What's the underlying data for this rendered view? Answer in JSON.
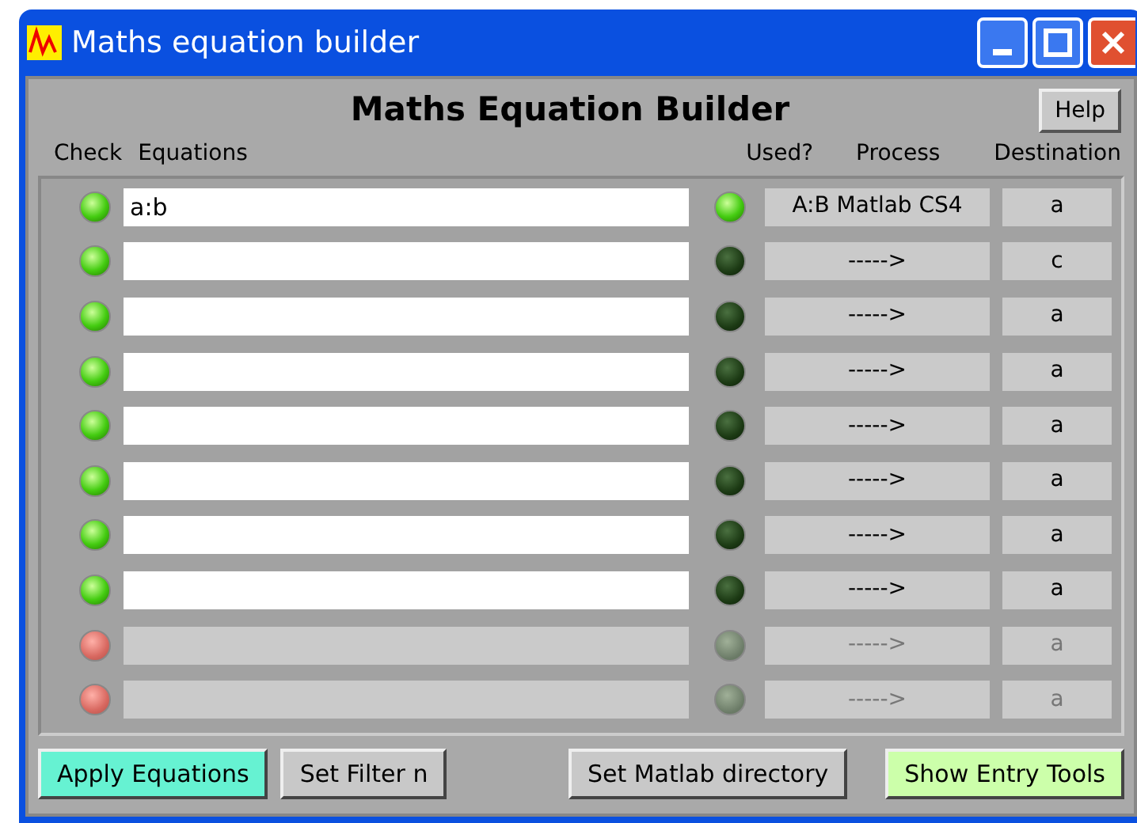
{
  "window": {
    "title": "Maths equation builder"
  },
  "heading": "Maths Equation Builder",
  "help_button": "Help",
  "columns": {
    "check": "Check",
    "equations": "Equations",
    "used": "Used?",
    "process": "Process",
    "destination": "Destination"
  },
  "rows": [
    {
      "check": true,
      "equation": "a:b",
      "used": true,
      "process": "A:B Matlab CS4",
      "destination": "a",
      "disabled": false
    },
    {
      "check": true,
      "used": false,
      "process": "----->",
      "destination": "c",
      "disabled": false
    },
    {
      "check": true,
      "used": false,
      "process": "----->",
      "destination": "a",
      "disabled": false
    },
    {
      "check": true,
      "used": false,
      "process": "----->",
      "destination": "a",
      "disabled": false
    },
    {
      "check": true,
      "used": false,
      "process": "----->",
      "destination": "a",
      "disabled": false
    },
    {
      "check": true,
      "used": false,
      "process": "----->",
      "destination": "a",
      "disabled": false
    },
    {
      "check": true,
      "used": false,
      "process": "----->",
      "destination": "a",
      "disabled": false
    },
    {
      "check": true,
      "used": false,
      "process": "----->",
      "destination": "a",
      "disabled": false
    },
    {
      "check": false,
      "used": false,
      "process": "----->",
      "destination": "a",
      "disabled": true
    },
    {
      "check": false,
      "used": false,
      "process": "----->",
      "destination": "a",
      "disabled": true
    }
  ],
  "buttons": [
    {
      "label": "Apply Equations",
      "color": "#66f2d2"
    },
    {
      "label": "Set Filter n",
      "color": "#c8c8c8"
    },
    {
      "label": "Set Matlab directory",
      "color": "#c8c8c8"
    },
    {
      "label": "Show Entry Tools",
      "color": "#ccffaa"
    }
  ]
}
